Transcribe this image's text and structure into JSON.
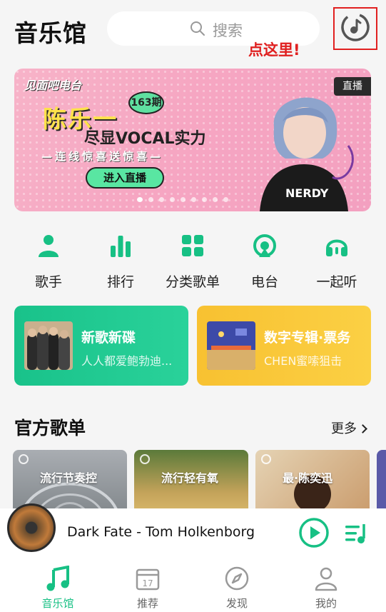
{
  "header": {
    "title": "音乐馆",
    "search_placeholder": "搜索",
    "callout": "点这里!"
  },
  "banner": {
    "brand": "见面吧电台",
    "issue": "163期",
    "name": "陈乐一",
    "subtitle": "尽显VOCAL实力",
    "tagline": "—连线惊喜送惊喜—",
    "cta": "进入直播",
    "live_badge": "直播",
    "page_count": 9,
    "active_page": 0
  },
  "categories": [
    {
      "label": "歌手",
      "icon": "singer-icon"
    },
    {
      "label": "排行",
      "icon": "chart-icon"
    },
    {
      "label": "分类歌单",
      "icon": "grid-icon"
    },
    {
      "label": "电台",
      "icon": "radio-icon"
    },
    {
      "label": "一起听",
      "icon": "headphones-icon"
    }
  ],
  "promos": [
    {
      "title": "新歌新碟",
      "subtitle": "人人都爱鲍勃迪...",
      "color": "#1dc48c"
    },
    {
      "title": "数字专辑·票务",
      "subtitle": "CHEN蜜嗦狙击",
      "color": "#f9c83a"
    }
  ],
  "section": {
    "title": "官方歌单",
    "more": "更多"
  },
  "playlists": [
    {
      "title": "流行节奏控"
    },
    {
      "title": "流行轻有氧"
    },
    {
      "title": "最·陈奕迅"
    }
  ],
  "player": {
    "song": "Dark Fate - Tom Holkenborg"
  },
  "nav": [
    {
      "label": "音乐馆",
      "active": true
    },
    {
      "label": "推荐",
      "active": false,
      "icon_text": "17"
    },
    {
      "label": "发现",
      "active": false
    },
    {
      "label": "我的",
      "active": false
    }
  ],
  "colors": {
    "accent": "#17c084",
    "callout": "#e02020"
  }
}
